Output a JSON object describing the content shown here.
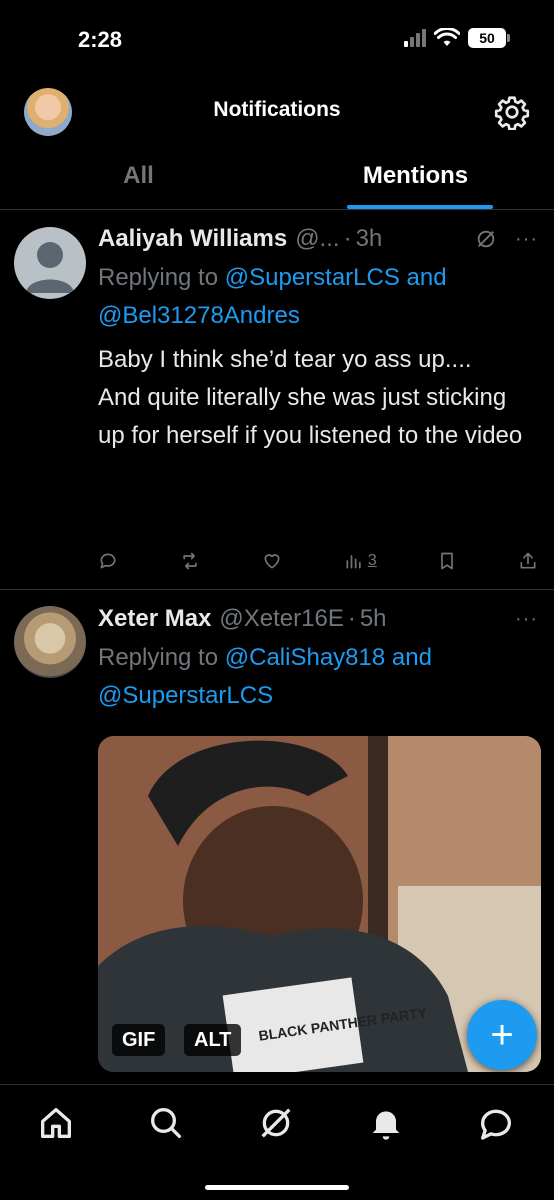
{
  "status_bar": {
    "time": "2:28",
    "battery": "50"
  },
  "header": {
    "title": "Notifications"
  },
  "tabs": [
    {
      "label": "All",
      "active": false
    },
    {
      "label": "Mentions",
      "active": true
    }
  ],
  "posts": [
    {
      "name": "Aaliyah Williams",
      "handle": "@...",
      "time": "3h",
      "replying_prefix": "Replying to",
      "mention1": "@SuperstarLCS",
      "and_word": "and",
      "mention2": "@Bel31278Andres",
      "text": "Baby I think she’d tear yo ass up....\nAnd quite literally she was just sticking up for herself if you listened to the video",
      "views": "3"
    },
    {
      "name": "Xeter Max",
      "handle": "@Xeter16E",
      "time": "5h",
      "replying_prefix": "Replying to",
      "mention1": "@CaliShay818",
      "and_word": "and",
      "mention2": "@SuperstarLCS",
      "media_badges": {
        "gif": "GIF",
        "alt": "ALT"
      },
      "shirt_text": "BLACK PANTHER PARTY"
    }
  ],
  "fab": {
    "label": "+"
  },
  "bottom_nav": [
    "home-icon",
    "search-icon",
    "grok-icon",
    "notifications-bell-icon",
    "messages-icon"
  ],
  "colors": {
    "accent": "#1d9bf0",
    "background": "#000000",
    "muted": "#71767b",
    "text": "#e7e9ea"
  }
}
